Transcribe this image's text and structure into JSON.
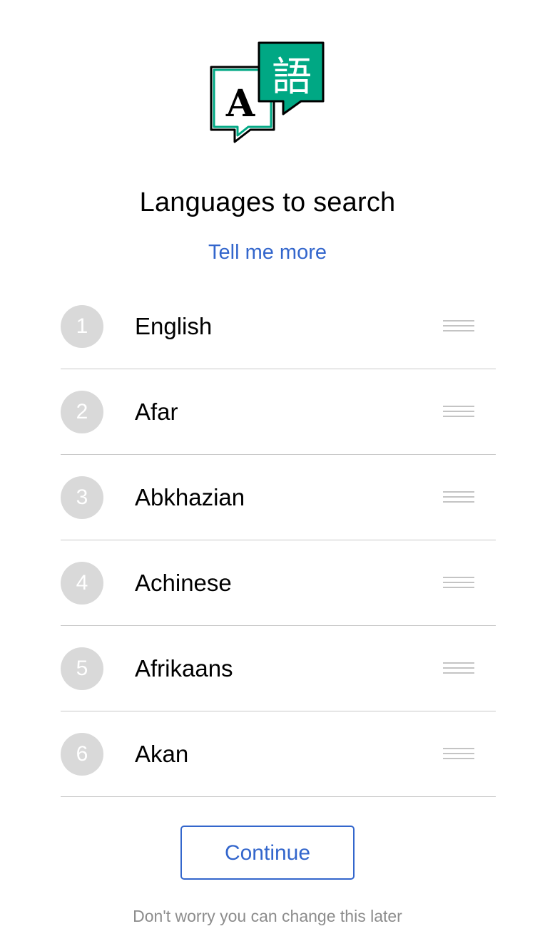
{
  "logo": {
    "icon": "translate-icon",
    "latin_glyph": "A",
    "cjk_glyph": "語",
    "accent_color": "#00a884"
  },
  "header": {
    "title": "Languages to search",
    "link_label": "Tell me more"
  },
  "languages": [
    {
      "rank": "1",
      "name": "English"
    },
    {
      "rank": "2",
      "name": "Afar"
    },
    {
      "rank": "3",
      "name": "Abkhazian"
    },
    {
      "rank": "4",
      "name": "Achinese"
    },
    {
      "rank": "5",
      "name": "Afrikaans"
    },
    {
      "rank": "6",
      "name": "Akan"
    }
  ],
  "actions": {
    "continue_label": "Continue",
    "footer_note": "Don't worry you can change this later"
  },
  "colors": {
    "link": "#3366cc",
    "badge": "#d9d9d9",
    "divider": "#c8c8c8",
    "muted_text": "#8c8c8c"
  }
}
